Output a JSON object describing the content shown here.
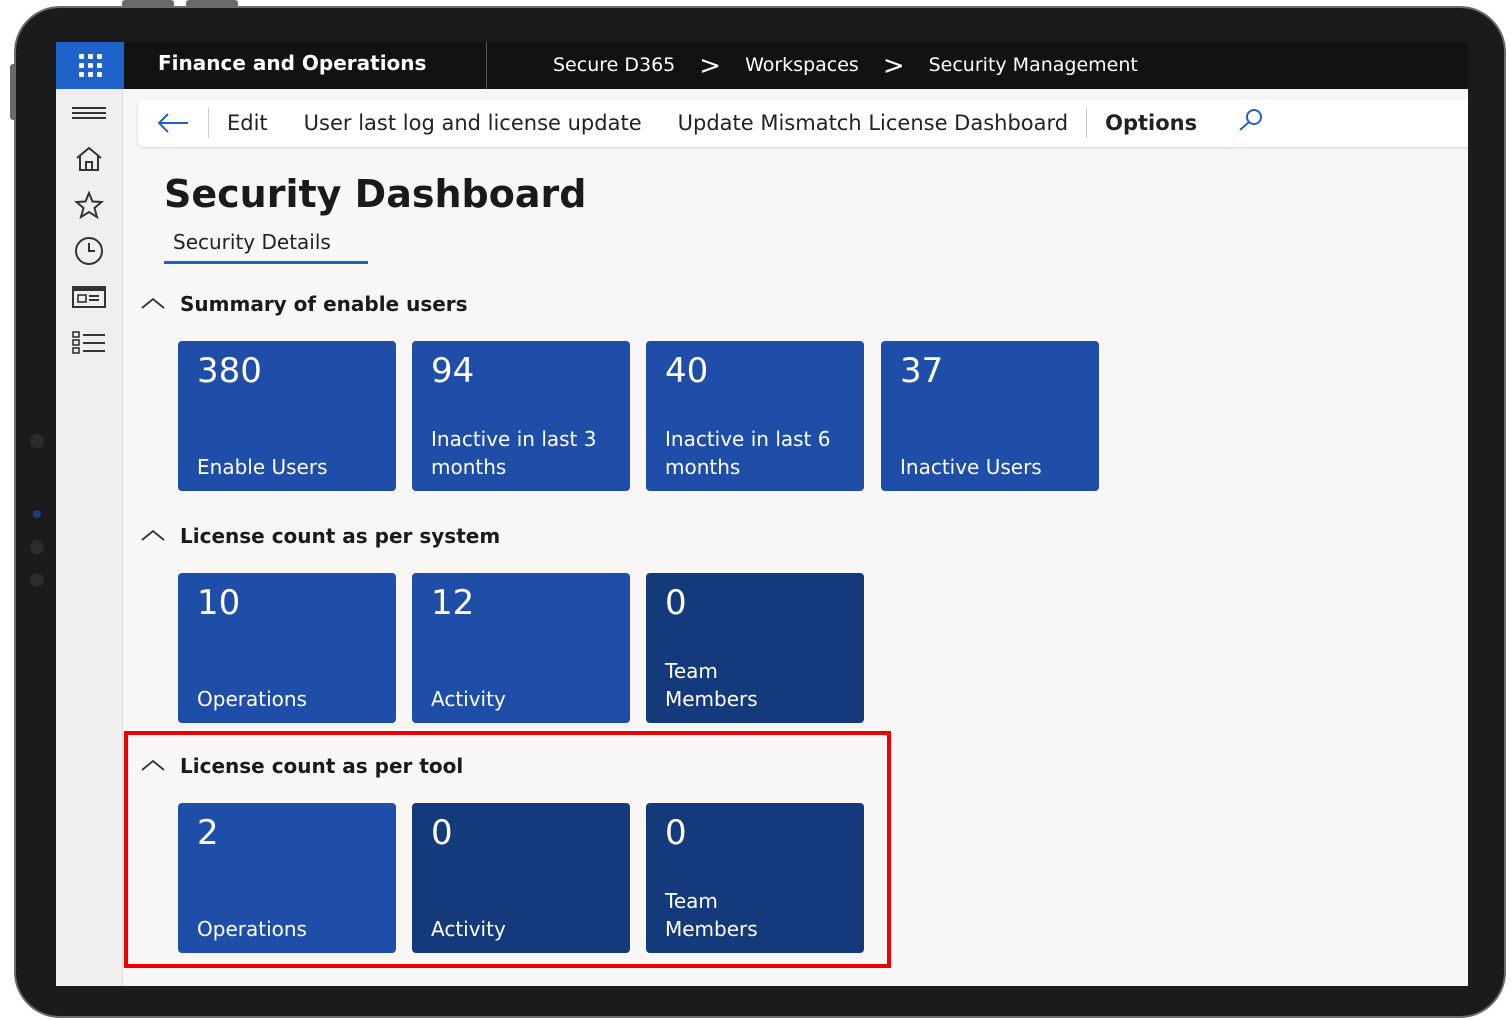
{
  "app": {
    "title": "Finance and Operations"
  },
  "breadcrumb": {
    "items": [
      "Secure D365",
      "Workspaces",
      "Security Management"
    ],
    "separator": ">"
  },
  "actionbar": {
    "items": [
      "Edit",
      "User last log and license update",
      "Update Mismatch License Dashboard"
    ],
    "options": "Options"
  },
  "page": {
    "title": "Security Dashboard",
    "tab": "Security Details"
  },
  "sections": [
    {
      "title": "Summary of enable users",
      "tiles": [
        {
          "count": "380",
          "label": "Enable Users",
          "shade": "light"
        },
        {
          "count": "94",
          "label": "Inactive in last 3 months",
          "shade": "light"
        },
        {
          "count": "40",
          "label": "Inactive in last 6 months",
          "shade": "light"
        },
        {
          "count": "37",
          "label": "Inactive Users",
          "shade": "light"
        }
      ]
    },
    {
      "title": "License count as per system",
      "tiles": [
        {
          "count": "10",
          "label": "Operations",
          "shade": "light"
        },
        {
          "count": "12",
          "label": "Activity",
          "shade": "light"
        },
        {
          "count": "0",
          "label": "Team Members",
          "shade": "dark"
        }
      ]
    },
    {
      "title": "License count as per tool",
      "tiles": [
        {
          "count": "2",
          "label": "Operations",
          "shade": "light"
        },
        {
          "count": "0",
          "label": "Activity",
          "shade": "dark"
        },
        {
          "count": "0",
          "label": "Team Members",
          "shade": "dark"
        }
      ]
    }
  ],
  "icons": {
    "waffle": "app-launcher-icon",
    "nav": [
      "hamburger-icon",
      "home-icon",
      "star-icon",
      "clock-icon",
      "workspace-icon",
      "list-icon"
    ],
    "back": "back-arrow-icon",
    "search": "search-icon",
    "collapse": "chevron-up-icon"
  },
  "colors": {
    "accent": "#1f62c9",
    "tile_light": "#1e4ea8",
    "tile_dark": "#143a7c",
    "highlight": "#ee0000",
    "topbar": "#121212"
  }
}
